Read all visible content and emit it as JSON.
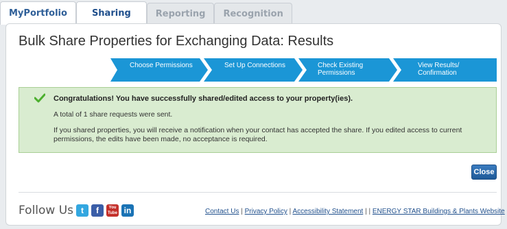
{
  "tabs": [
    {
      "label": "MyPortfolio"
    },
    {
      "label": "Sharing"
    },
    {
      "label": "Reporting"
    },
    {
      "label": "Recognition"
    }
  ],
  "page": {
    "title": "Bulk Share Properties for Exchanging Data: Results"
  },
  "steps": [
    {
      "label": "Choose Permissions"
    },
    {
      "label": "Set Up Connections"
    },
    {
      "label": "Check Existing Permissions"
    },
    {
      "label": "View Results/ Confirmation"
    }
  ],
  "message": {
    "title": "Congratulations! You have successfully shared/edited access to your property(ies).",
    "line1": "A total of 1 share requests were sent.",
    "line2": "If you shared properties, you will receive a notification when your contact has accepted the share. If you edited access to current permissions, the edits have been made, no acceptance is required."
  },
  "close_label": "Close",
  "footer": {
    "follow_label": "Follow Us",
    "social": [
      {
        "icon": "twitter-icon",
        "glyph": "t",
        "color": "#33a7e0"
      },
      {
        "icon": "facebook-icon",
        "glyph": "f",
        "color": "#3b5ea8"
      },
      {
        "icon": "youtube-icon",
        "glyph": "You Tube",
        "color": "#c4302b"
      },
      {
        "icon": "linkedin-icon",
        "glyph": "in",
        "color": "#1a73b5"
      }
    ],
    "links": [
      "Contact Us",
      "Privacy Policy",
      "Accessibility Statement",
      "ENERGY STAR Buildings & Plants Website"
    ]
  },
  "colors": {
    "step_blue": "#1b96d6",
    "success_bg": "#d9ecd0",
    "check_green": "#4caf2e"
  }
}
